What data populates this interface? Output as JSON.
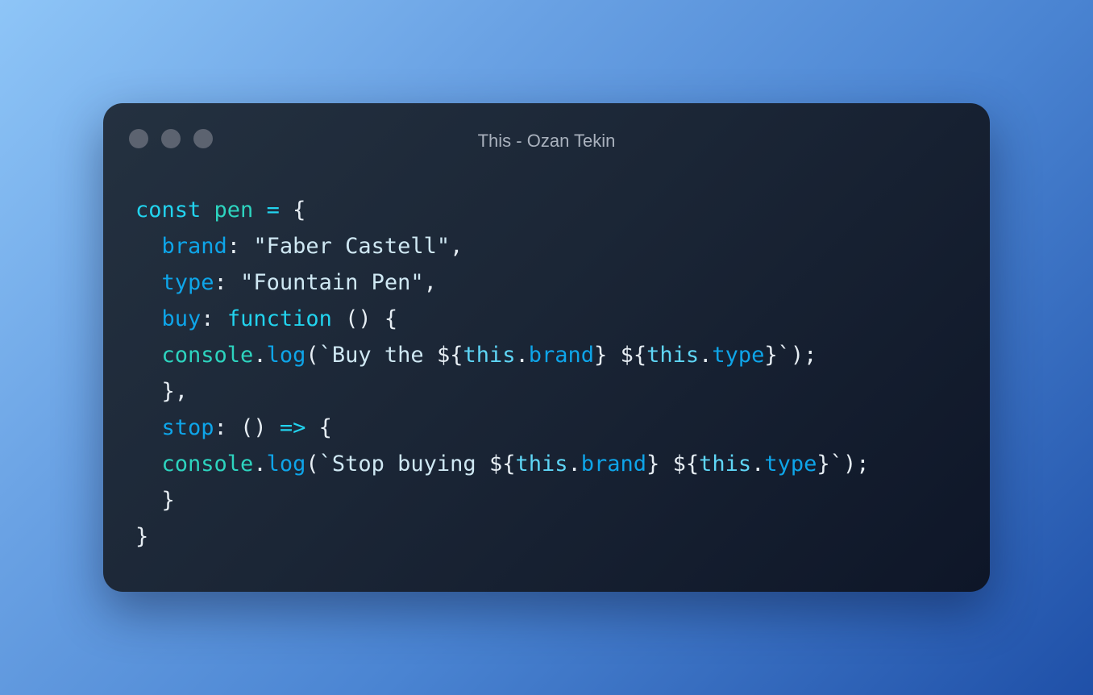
{
  "window": {
    "title": "This - Ozan Tekin"
  },
  "code": {
    "l1": {
      "kw": "const",
      "name": "pen",
      "op": "=",
      "brace": "{"
    },
    "l2": {
      "prop": "brand",
      "colon": ":",
      "value": "\"Faber Castell\"",
      "comma": ","
    },
    "l3": {
      "prop": "type",
      "colon": ":",
      "value": "\"Fountain Pen\"",
      "comma": ","
    },
    "l4": {
      "prop": "buy",
      "colon": ":",
      "kw": "function",
      "parens": "()",
      "brace": "{"
    },
    "l5": {
      "obj": "console",
      "dot": ".",
      "meth": "log",
      "open": "(",
      "text": "`Buy the ",
      "d1": "${",
      "this1": "this",
      "dot1": ".",
      "p1": "brand",
      "c1": "}",
      "sp": " ",
      "d2": "${",
      "this2": "this",
      "dot2": ".",
      "p2": "type",
      "c2": "}",
      "end": "`);"
    },
    "l6": {
      "text": "},"
    },
    "l7": {
      "prop": "stop",
      "colon": ":",
      "parens": "()",
      "arrow": "=>",
      "brace": "{"
    },
    "l8": {
      "obj": "console",
      "dot": ".",
      "meth": "log",
      "open": "(",
      "text": "`Stop buying ",
      "d1": "${",
      "this1": "this",
      "dot1": ".",
      "p1": "brand",
      "c1": "}",
      "sp": " ",
      "d2": "${",
      "this2": "this",
      "dot2": ".",
      "p2": "type",
      "c2": "}",
      "end": "`);"
    },
    "l9": {
      "text": "}"
    },
    "l10": {
      "text": "}"
    }
  }
}
